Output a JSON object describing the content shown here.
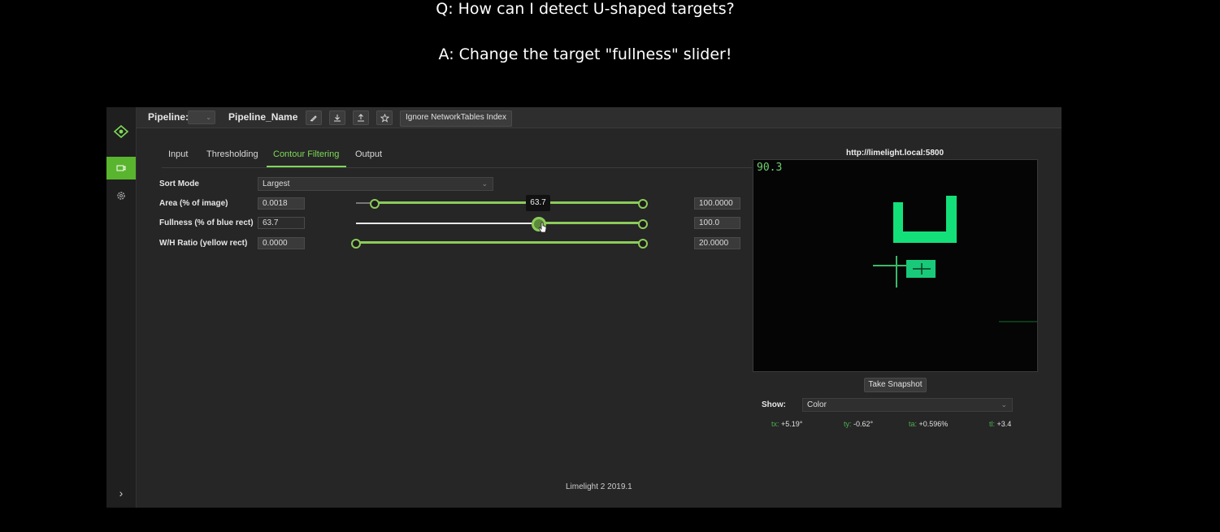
{
  "caption": {
    "question": "Q: How can I detect U-shaped targets?",
    "answer": "A: Change the target \"fullness\" slider!"
  },
  "topbar": {
    "pipeline_label": "Pipeline:",
    "pipeline_name": "Pipeline_Name",
    "ignore_nt_label": "Ignore NetworkTables Index"
  },
  "tabs": [
    {
      "label": "Input"
    },
    {
      "label": "Thresholding"
    },
    {
      "label": "Contour Filtering",
      "active": true
    },
    {
      "label": "Output"
    }
  ],
  "filters": {
    "sort_mode_label": "Sort Mode",
    "sort_mode_value": "Largest",
    "area": {
      "label": "Area (% of image)",
      "min": "0.0018",
      "max": "100.0000",
      "min_fraction": 0.066,
      "max_fraction": 1.0
    },
    "fullness": {
      "label": "Fullness (% of blue rect)",
      "min": "63.7",
      "max": "100.0",
      "min_fraction": 0.637,
      "max_fraction": 1.0,
      "tooltip": "63.7"
    },
    "wh_ratio": {
      "label": "W/H Ratio (yellow rect)",
      "min": "0.0000",
      "max": "20.0000",
      "min_fraction": 0.0,
      "max_fraction": 1.0
    }
  },
  "camera": {
    "url": "http://limelight.local:5800",
    "fps": "90.3",
    "snapshot_label": "Take Snapshot",
    "show_label": "Show:",
    "show_value": "Color"
  },
  "stats": [
    {
      "key": "tx:",
      "value": "+5.19°"
    },
    {
      "key": "ty:",
      "value": "-0.62°"
    },
    {
      "key": "ta:",
      "value": "+0.596%"
    },
    {
      "key": "tl:",
      "value": "+3.4"
    }
  ],
  "footer": "Limelight 2 2019.1",
  "colors": {
    "accent": "#7ed957",
    "target": "#14e07a",
    "background": "#262626"
  }
}
